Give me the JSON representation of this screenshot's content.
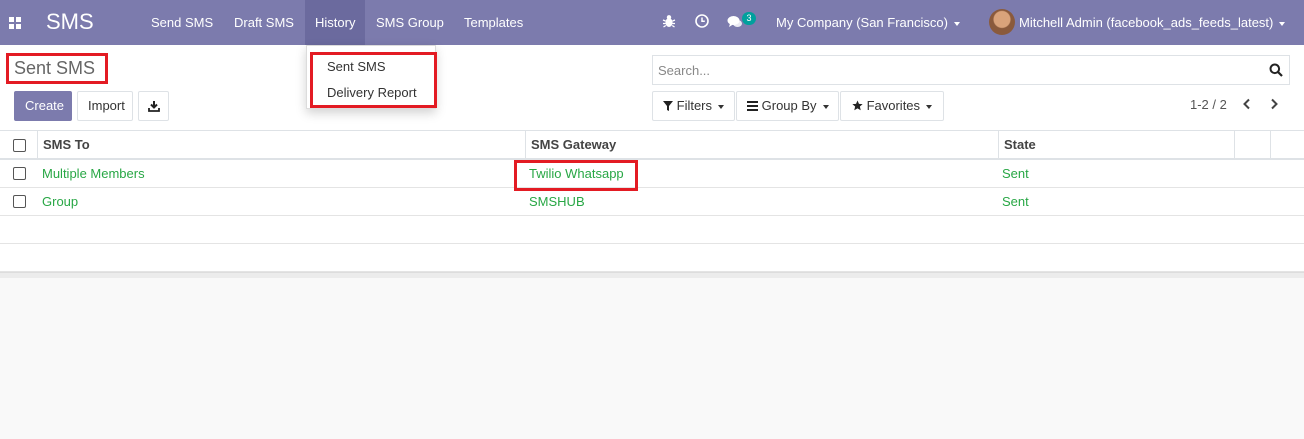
{
  "navbar": {
    "brand": "SMS",
    "menu": [
      "Send SMS",
      "Draft SMS",
      "History",
      "SMS Group",
      "Templates"
    ],
    "active_menu": "History",
    "chat_badge": "3",
    "company": "My Company (San Francisco)",
    "user": "Mitchell Admin (facebook_ads_feeds_latest)",
    "color": "#7c7bad"
  },
  "history_dropdown": {
    "items": [
      "Sent SMS",
      "Delivery Report"
    ]
  },
  "control_panel": {
    "title": "Sent SMS",
    "create_label": "Create",
    "import_label": "Import",
    "search_placeholder": "Search...",
    "filters_label": "Filters",
    "groupby_label": "Group By",
    "favorites_label": "Favorites",
    "pager": "1-2 / 2"
  },
  "table": {
    "columns": [
      "SMS To",
      "SMS Gateway",
      "State"
    ],
    "rows": [
      {
        "to": "Multiple Members",
        "gateway": "Twilio Whatsapp",
        "state": "Sent"
      },
      {
        "to": "Group",
        "gateway": "SMSHUB",
        "state": "Sent"
      }
    ]
  },
  "colors": {
    "accent": "#7c7bad",
    "link_green": "#28a745",
    "highlight_red": "#e31b23"
  }
}
